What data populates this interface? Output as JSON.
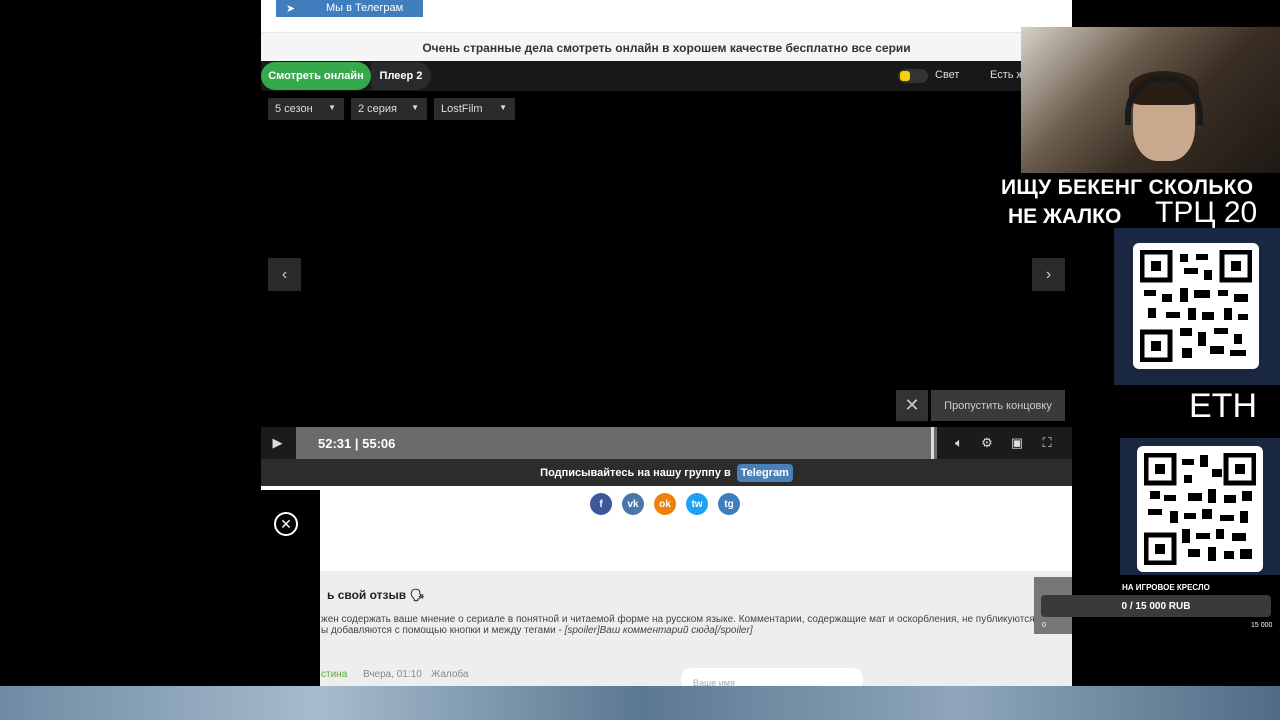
{
  "page": {
    "telegram_button": "Мы в Телеграм",
    "title": "Очень странные дела смотреть онлайн в хорошем качестве бесплатно все серии"
  },
  "player": {
    "tabs": [
      "Смотреть онлайн",
      "Плеер 2"
    ],
    "light_label": "Свет",
    "errors_label": "Есть ж",
    "season": "5 сезон",
    "episode": "2 серия",
    "voice": "LostFilm",
    "skip_button": "Пропустить концовку",
    "time": "52:31 | 55:06",
    "progress": 0.996,
    "subscribe_text": "Подписывайтесь на нашу группу в",
    "subscribe_link": "Telegram"
  },
  "share": [
    "f",
    "vk",
    "ok",
    "tw",
    "tg"
  ],
  "review": {
    "title": "ь свой отзыв 🗣",
    "rule1": "жен содержать ваше мнение о сериале в понятной и читаемой форме на русском языке. Комментарии, содержащие мат и оскорбления, не публикуются.",
    "rule2_prefix": "ы добавляются с помощью кнопки и между тегами - ",
    "rule2_example": "[spoiler]Ваш комментарий сюда[/spoiler]",
    "comment_author": "стина",
    "comment_date": "Вчера, 01:10",
    "comment_report": "Жалоба",
    "name_placeholder": "Ваше имя"
  },
  "stream": {
    "message_line1": "ИЩУ БЕКЕНГ СКОЛЬКО",
    "message_line2": "НЕ ЖАЛКО",
    "trc_label": "ТРЦ 20",
    "eth_label": "ETH",
    "goal_label": "НА ИГРОВОЕ КРЕСЛО",
    "goal_value": "0 / 15 000 RUB",
    "goal_min": "0",
    "goal_max": "15 000"
  },
  "colors": {
    "accent_green": "#37a94d",
    "telegram_blue": "#3f7dbd",
    "light_yellow": "#f3d400"
  }
}
